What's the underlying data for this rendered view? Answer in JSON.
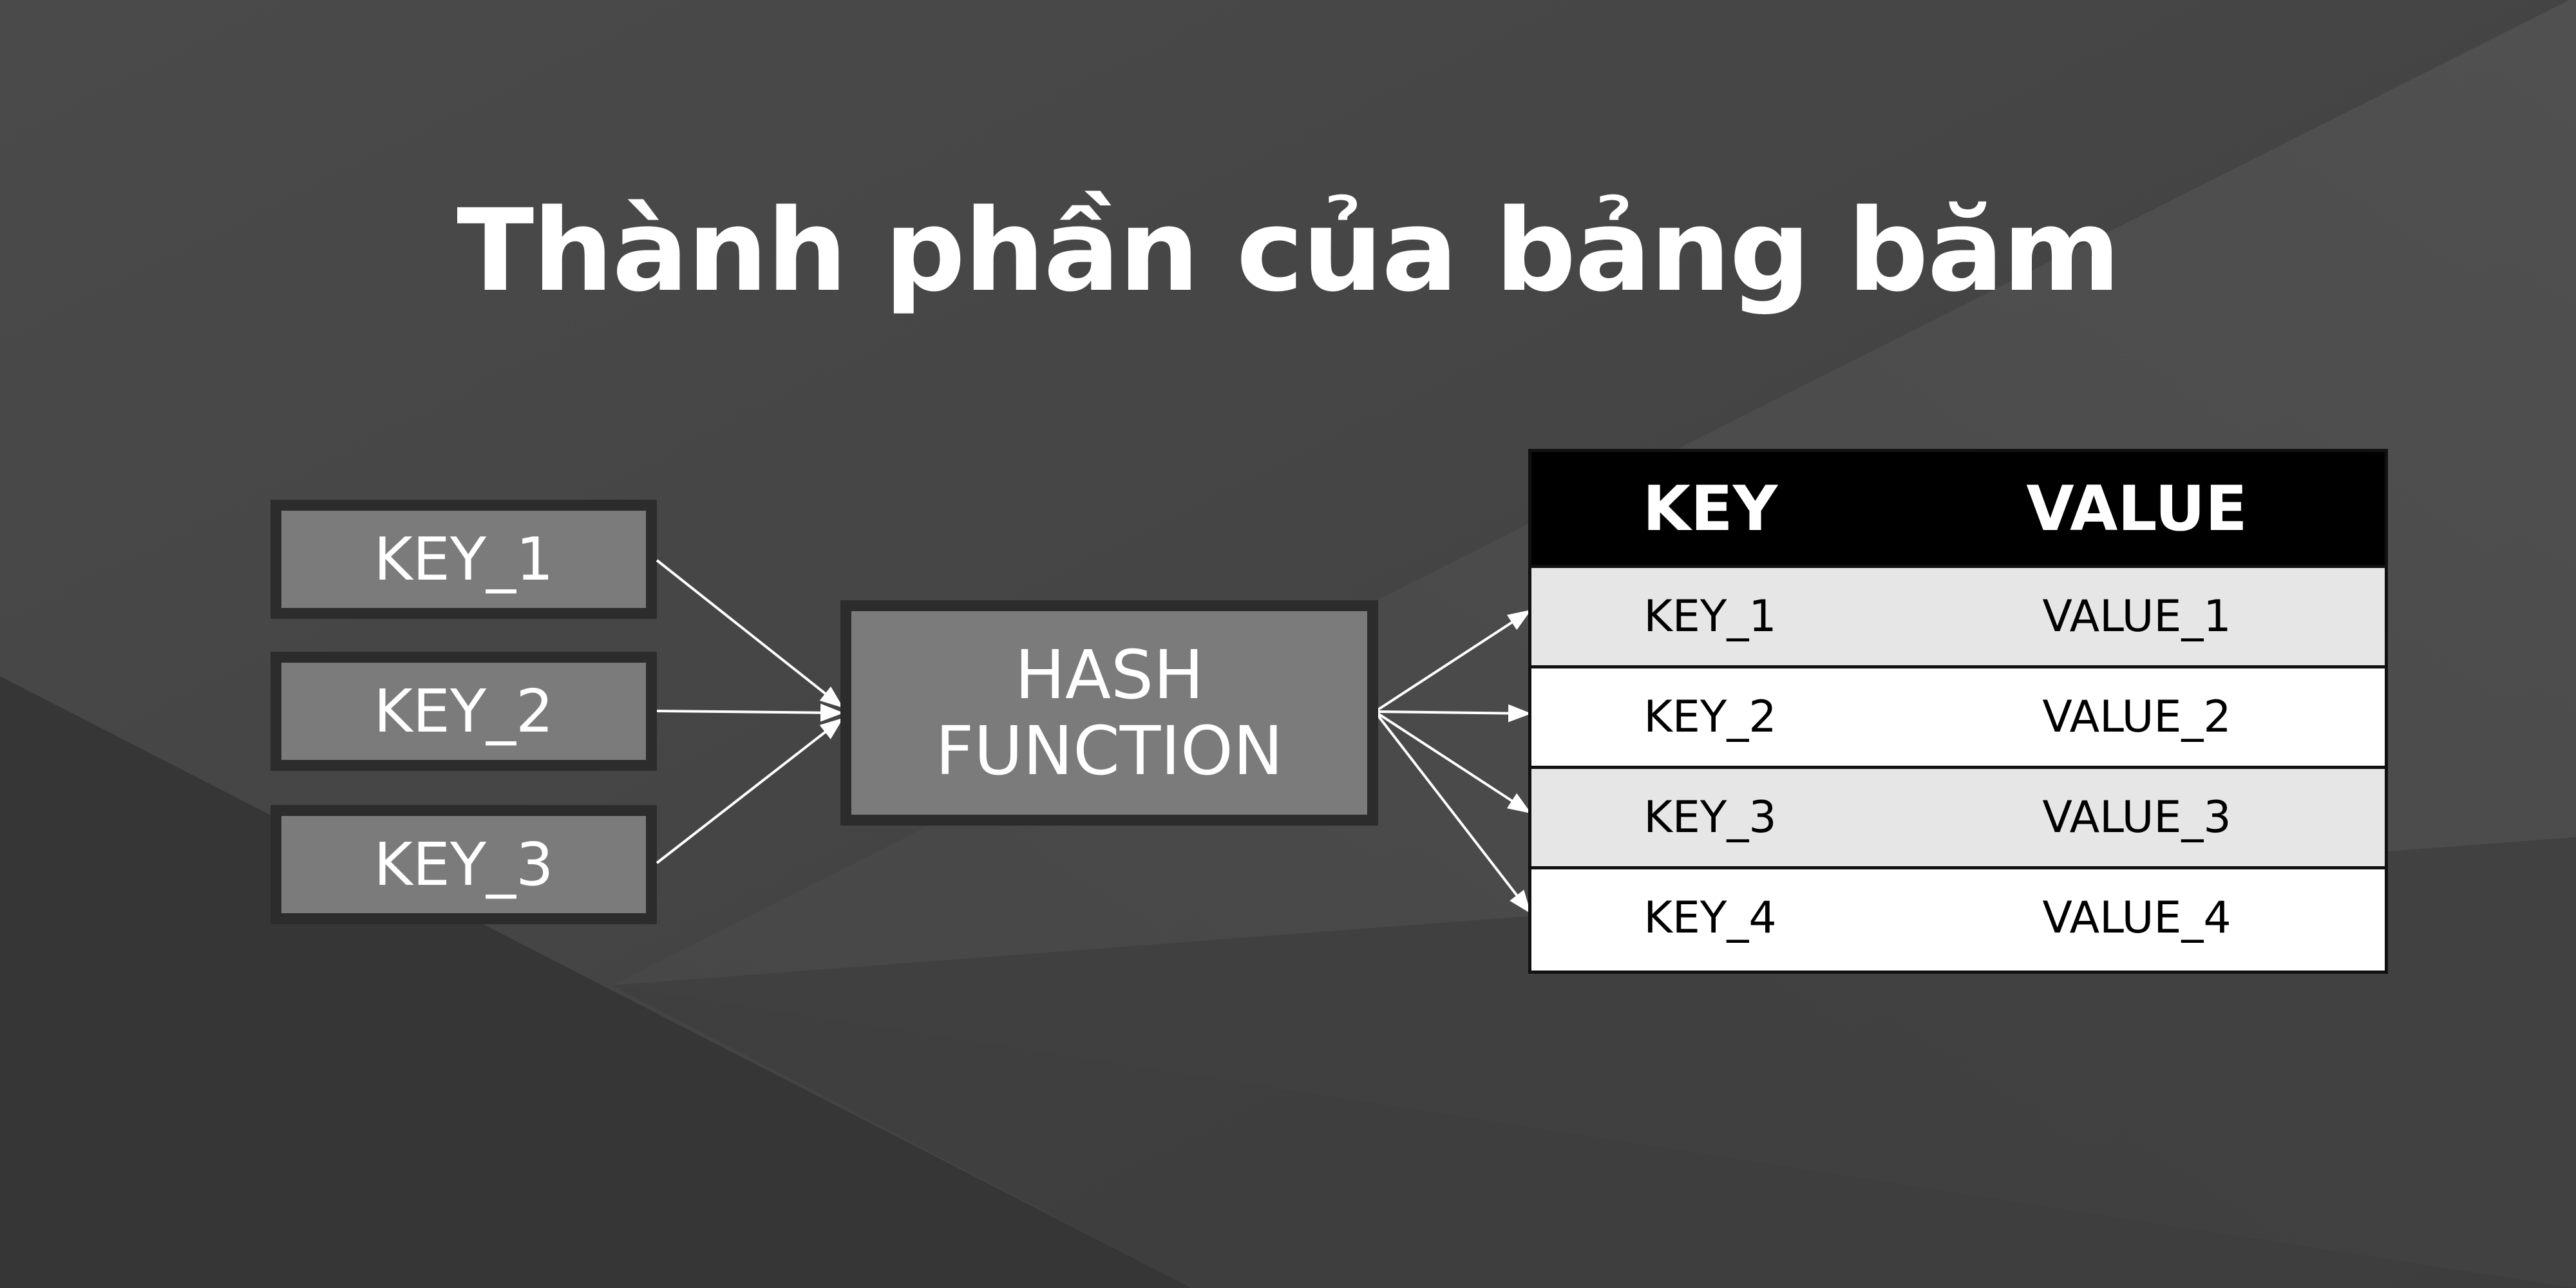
{
  "title": "Thành phần của bảng băm",
  "keys": [
    "KEY_1",
    "KEY_2",
    "KEY_3"
  ],
  "hash_function": {
    "line1": "HASH",
    "line2": "FUNCTION"
  },
  "table": {
    "header_key": "KEY",
    "header_value": "VALUE",
    "rows": [
      {
        "key": "KEY_1",
        "value": "VALUE_1"
      },
      {
        "key": "KEY_2",
        "value": "VALUE_2"
      },
      {
        "key": "KEY_3",
        "value": "VALUE_3"
      },
      {
        "key": "KEY_4",
        "value": "VALUE_4"
      }
    ]
  },
  "colors": {
    "background": "#444444",
    "box_fill": "#7b7b7b",
    "box_border": "#2c2c2c",
    "table_header": "#000000",
    "row_shaded": "#e6e6e6",
    "row_plain": "#ffffff",
    "arrow": "#ffffff"
  }
}
